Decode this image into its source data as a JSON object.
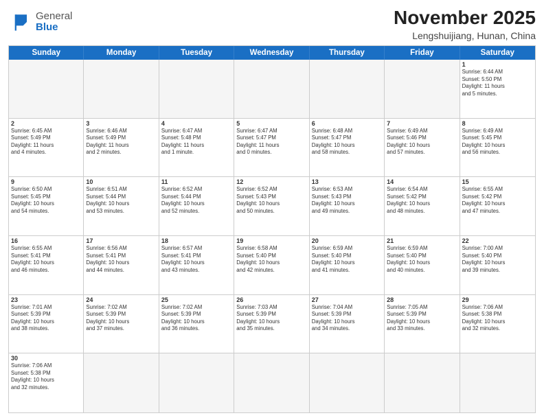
{
  "header": {
    "logo": {
      "line1": "General",
      "line2": "Blue"
    },
    "title": "November 2025",
    "location": "Lengshuijiang, Hunan, China"
  },
  "day_headers": [
    "Sunday",
    "Monday",
    "Tuesday",
    "Wednesday",
    "Thursday",
    "Friday",
    "Saturday"
  ],
  "weeks": [
    {
      "days": [
        {
          "num": "",
          "info": "",
          "empty": true
        },
        {
          "num": "",
          "info": "",
          "empty": true
        },
        {
          "num": "",
          "info": "",
          "empty": true
        },
        {
          "num": "",
          "info": "",
          "empty": true
        },
        {
          "num": "",
          "info": "",
          "empty": true
        },
        {
          "num": "",
          "info": "",
          "empty": true
        },
        {
          "num": "1",
          "info": "Sunrise: 6:44 AM\nSunset: 5:50 PM\nDaylight: 11 hours\nand 5 minutes.",
          "empty": false
        }
      ]
    },
    {
      "days": [
        {
          "num": "2",
          "info": "Sunrise: 6:45 AM\nSunset: 5:49 PM\nDaylight: 11 hours\nand 4 minutes.",
          "empty": false
        },
        {
          "num": "3",
          "info": "Sunrise: 6:46 AM\nSunset: 5:49 PM\nDaylight: 11 hours\nand 2 minutes.",
          "empty": false
        },
        {
          "num": "4",
          "info": "Sunrise: 6:47 AM\nSunset: 5:48 PM\nDaylight: 11 hours\nand 1 minute.",
          "empty": false
        },
        {
          "num": "5",
          "info": "Sunrise: 6:47 AM\nSunset: 5:47 PM\nDaylight: 11 hours\nand 0 minutes.",
          "empty": false
        },
        {
          "num": "6",
          "info": "Sunrise: 6:48 AM\nSunset: 5:47 PM\nDaylight: 10 hours\nand 58 minutes.",
          "empty": false
        },
        {
          "num": "7",
          "info": "Sunrise: 6:49 AM\nSunset: 5:46 PM\nDaylight: 10 hours\nand 57 minutes.",
          "empty": false
        },
        {
          "num": "8",
          "info": "Sunrise: 6:49 AM\nSunset: 5:45 PM\nDaylight: 10 hours\nand 56 minutes.",
          "empty": false
        }
      ]
    },
    {
      "days": [
        {
          "num": "9",
          "info": "Sunrise: 6:50 AM\nSunset: 5:45 PM\nDaylight: 10 hours\nand 54 minutes.",
          "empty": false
        },
        {
          "num": "10",
          "info": "Sunrise: 6:51 AM\nSunset: 5:44 PM\nDaylight: 10 hours\nand 53 minutes.",
          "empty": false
        },
        {
          "num": "11",
          "info": "Sunrise: 6:52 AM\nSunset: 5:44 PM\nDaylight: 10 hours\nand 52 minutes.",
          "empty": false
        },
        {
          "num": "12",
          "info": "Sunrise: 6:52 AM\nSunset: 5:43 PM\nDaylight: 10 hours\nand 50 minutes.",
          "empty": false
        },
        {
          "num": "13",
          "info": "Sunrise: 6:53 AM\nSunset: 5:43 PM\nDaylight: 10 hours\nand 49 minutes.",
          "empty": false
        },
        {
          "num": "14",
          "info": "Sunrise: 6:54 AM\nSunset: 5:42 PM\nDaylight: 10 hours\nand 48 minutes.",
          "empty": false
        },
        {
          "num": "15",
          "info": "Sunrise: 6:55 AM\nSunset: 5:42 PM\nDaylight: 10 hours\nand 47 minutes.",
          "empty": false
        }
      ]
    },
    {
      "days": [
        {
          "num": "16",
          "info": "Sunrise: 6:55 AM\nSunset: 5:41 PM\nDaylight: 10 hours\nand 46 minutes.",
          "empty": false
        },
        {
          "num": "17",
          "info": "Sunrise: 6:56 AM\nSunset: 5:41 PM\nDaylight: 10 hours\nand 44 minutes.",
          "empty": false
        },
        {
          "num": "18",
          "info": "Sunrise: 6:57 AM\nSunset: 5:41 PM\nDaylight: 10 hours\nand 43 minutes.",
          "empty": false
        },
        {
          "num": "19",
          "info": "Sunrise: 6:58 AM\nSunset: 5:40 PM\nDaylight: 10 hours\nand 42 minutes.",
          "empty": false
        },
        {
          "num": "20",
          "info": "Sunrise: 6:59 AM\nSunset: 5:40 PM\nDaylight: 10 hours\nand 41 minutes.",
          "empty": false
        },
        {
          "num": "21",
          "info": "Sunrise: 6:59 AM\nSunset: 5:40 PM\nDaylight: 10 hours\nand 40 minutes.",
          "empty": false
        },
        {
          "num": "22",
          "info": "Sunrise: 7:00 AM\nSunset: 5:40 PM\nDaylight: 10 hours\nand 39 minutes.",
          "empty": false
        }
      ]
    },
    {
      "days": [
        {
          "num": "23",
          "info": "Sunrise: 7:01 AM\nSunset: 5:39 PM\nDaylight: 10 hours\nand 38 minutes.",
          "empty": false
        },
        {
          "num": "24",
          "info": "Sunrise: 7:02 AM\nSunset: 5:39 PM\nDaylight: 10 hours\nand 37 minutes.",
          "empty": false
        },
        {
          "num": "25",
          "info": "Sunrise: 7:02 AM\nSunset: 5:39 PM\nDaylight: 10 hours\nand 36 minutes.",
          "empty": false
        },
        {
          "num": "26",
          "info": "Sunrise: 7:03 AM\nSunset: 5:39 PM\nDaylight: 10 hours\nand 35 minutes.",
          "empty": false
        },
        {
          "num": "27",
          "info": "Sunrise: 7:04 AM\nSunset: 5:39 PM\nDaylight: 10 hours\nand 34 minutes.",
          "empty": false
        },
        {
          "num": "28",
          "info": "Sunrise: 7:05 AM\nSunset: 5:39 PM\nDaylight: 10 hours\nand 33 minutes.",
          "empty": false
        },
        {
          "num": "29",
          "info": "Sunrise: 7:06 AM\nSunset: 5:38 PM\nDaylight: 10 hours\nand 32 minutes.",
          "empty": false
        }
      ]
    },
    {
      "days": [
        {
          "num": "30",
          "info": "Sunrise: 7:06 AM\nSunset: 5:38 PM\nDaylight: 10 hours\nand 32 minutes.",
          "empty": false
        },
        {
          "num": "",
          "info": "",
          "empty": true
        },
        {
          "num": "",
          "info": "",
          "empty": true
        },
        {
          "num": "",
          "info": "",
          "empty": true
        },
        {
          "num": "",
          "info": "",
          "empty": true
        },
        {
          "num": "",
          "info": "",
          "empty": true
        },
        {
          "num": "",
          "info": "",
          "empty": true
        }
      ]
    }
  ]
}
